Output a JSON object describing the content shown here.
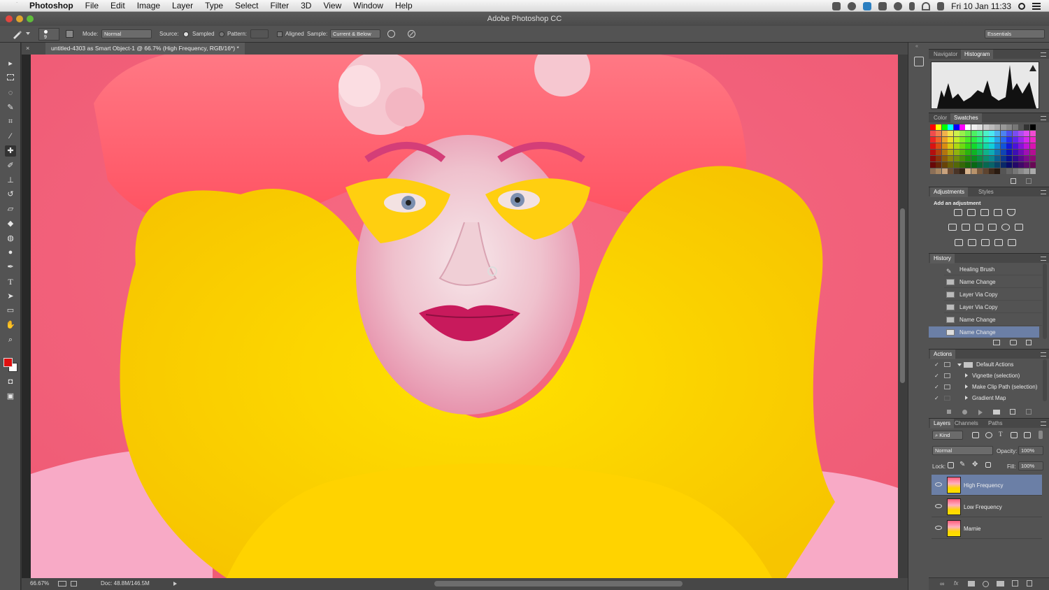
{
  "menubar": {
    "app": "Photoshop",
    "items": [
      "File",
      "Edit",
      "Image",
      "Layer",
      "Type",
      "Select",
      "Filter",
      "3D",
      "View",
      "Window",
      "Help"
    ],
    "clock": "Fri 10 Jan  11:33"
  },
  "window": {
    "title": "Adobe Photoshop CC"
  },
  "options": {
    "mode_label": "Mode:",
    "mode_value": "Normal",
    "source_label": "Source:",
    "sampled_label": "Sampled",
    "pattern_label": "Pattern:",
    "aligned_label": "Aligned",
    "sample_label": "Sample:",
    "sample_value": "Current & Below",
    "brush_size": "9",
    "workspace": "Essentials"
  },
  "document": {
    "tab_title": "untitled-4303 as Smart Object-1 @ 66.7% (High Frequency, RGB/16*) *",
    "zoom": "66.67%",
    "doc_info": "Doc: 48.8M/146.5M"
  },
  "panels": {
    "navigator_tab": "Navigator",
    "histogram_tab": "Histogram",
    "color_tab": "Color",
    "swatches_tab": "Swatches",
    "adjustments_tab": "Adjustments",
    "styles_tab": "Styles",
    "add_adjustment": "Add an adjustment",
    "history_tab": "History",
    "history_items": [
      "Healing Brush",
      "Name Change",
      "Layer Via Copy",
      "Layer Via Copy",
      "Name Change",
      "Name Change"
    ],
    "actions_tab": "Actions",
    "actions": [
      "Default Actions",
      "Vignette (selection)",
      "Make Clip Path (selection)",
      "Gradient Map"
    ],
    "layers_tab": "Layers",
    "channels_tab": "Channels",
    "paths_tab": "Paths",
    "kind_filter": "Kind",
    "blend_mode": "Normal",
    "opacity_label": "Opacity:",
    "opacity_value": "100%",
    "lock_label": "Lock:",
    "fill_label": "Fill:",
    "fill_value": "100%",
    "layers": [
      "High Frequency",
      "Low Frequency",
      "Marnie"
    ]
  },
  "colors": {
    "foreground": "#e01010",
    "background": "#ffffff",
    "selection": "#6b7fa6"
  }
}
